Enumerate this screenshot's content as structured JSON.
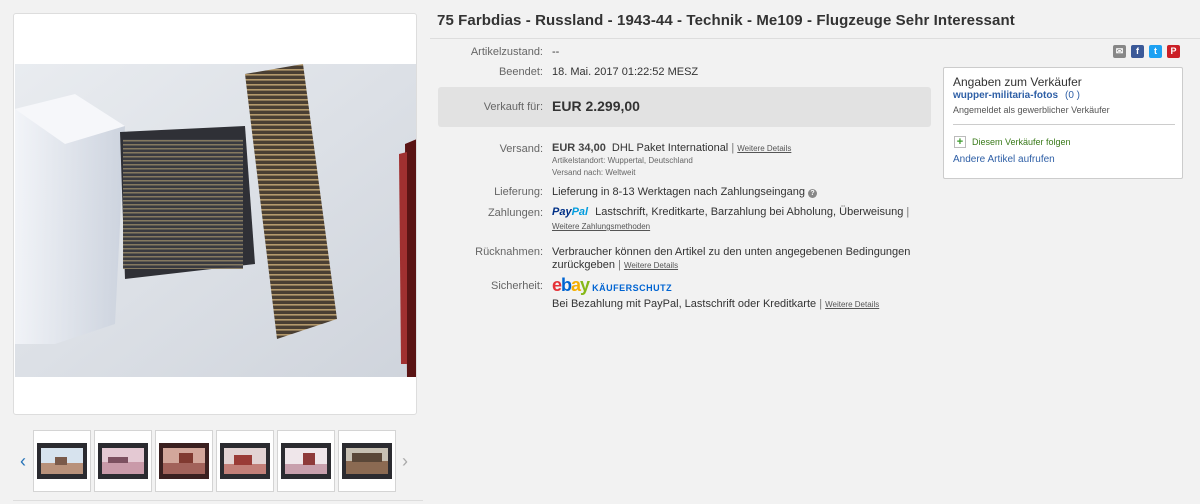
{
  "title": "75 Farbdias - Russland - 1943-44 - Technik - Me109 - Flugzeuge Sehr Interessant",
  "details": {
    "condition": {
      "label": "Artikelzustand:",
      "value": "--"
    },
    "ended": {
      "label": "Beendet:",
      "value": "18. Mai. 2017  01:22:52 MESZ"
    },
    "sold": {
      "label": "Verkauft für:",
      "value": "EUR 2.299,00"
    },
    "shipping": {
      "label": "Versand:",
      "price": "EUR 34,00",
      "service": "DHL Paket International",
      "details_link": "Weitere Details",
      "location": "Artikelstandort:  Wuppertal, Deutschland",
      "ships_to": "Versand nach:  Weltweit"
    },
    "delivery": {
      "label": "Lieferung:",
      "value": "Lieferung in 8-13 Werktagen nach Zahlungseingang"
    },
    "payments": {
      "label": "Zahlungen:",
      "paypal_part1": "Pay",
      "paypal_part2": "Pal",
      "methods": "Lastschrift,  Kreditkarte,  Barzahlung bei Abholung,  Überweisung",
      "more_link": "Weitere Zahlungsmethoden"
    },
    "returns": {
      "label": "Rücknahmen:",
      "line1": "Verbraucher können den Artikel zu den unten angegebenen Bedingungen",
      "line2": "zurückgeben",
      "details_link": "Weitere Details"
    },
    "security": {
      "label": "Sicherheit:",
      "badge": "KÄUFERSCHUTZ",
      "text": "Bei Bezahlung mit PayPal, Lastschrift oder Kreditkarte",
      "details_link": "Weitere Details"
    }
  },
  "share_icons": [
    {
      "name": "email-icon",
      "glyph": "✉",
      "color": "#888888"
    },
    {
      "name": "facebook-icon",
      "glyph": "f",
      "color": "#3b5998"
    },
    {
      "name": "twitter-icon",
      "glyph": "t",
      "color": "#1da1f2"
    },
    {
      "name": "pinterest-icon",
      "glyph": "P",
      "color": "#cb2027"
    }
  ],
  "seller": {
    "heading": "Angaben zum Verkäufer",
    "name": "wupper-militaria-fotos",
    "score": "(0 )",
    "status": "Angemeldet als gewerblicher Verkäufer",
    "follow": "Diesem Verkäufer folgen",
    "other_items": "Andere Artikel aufrufen"
  },
  "gallery": {
    "prev_glyph": "‹",
    "next_glyph": "›",
    "thumb_count": 6
  }
}
